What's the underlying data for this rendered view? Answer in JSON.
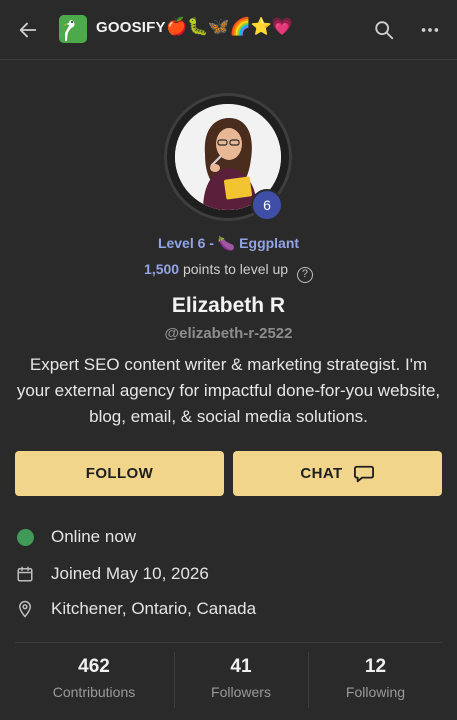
{
  "header": {
    "brand": "GOOSIFY",
    "emojis": "🍎🐛🦋🌈⭐💗",
    "icons": {
      "back": "arrow-left-icon",
      "search": "search-icon",
      "more": "more-horizontal-icon"
    }
  },
  "profile": {
    "level_badge": "6",
    "level_text": "Level 6 - 🍆 Eggplant",
    "points": "1,500",
    "points_suffix": "points to level up",
    "help_glyph": "?",
    "name": "Elizabeth R",
    "handle": "@elizabeth-r-2522",
    "bio": "Expert SEO content writer & marketing strategist. I'm your external agency for impactful done-for-you website, blog, email, & social media solutions."
  },
  "actions": {
    "follow_label": "FOLLOW",
    "chat_label": "CHAT"
  },
  "info": {
    "status": "Online now",
    "joined": "Joined May 10, 2026",
    "location": "Kitchener, Ontario, Canada"
  },
  "stats": [
    {
      "value": "462",
      "label": "Contributions"
    },
    {
      "value": "41",
      "label": "Followers"
    },
    {
      "value": "12",
      "label": "Following"
    }
  ],
  "colors": {
    "background": "#2a2a2a",
    "accent_button": "#f1d58a",
    "level_text": "#93a4e6",
    "badge": "#3f4fa8",
    "online": "#3f9a57"
  }
}
